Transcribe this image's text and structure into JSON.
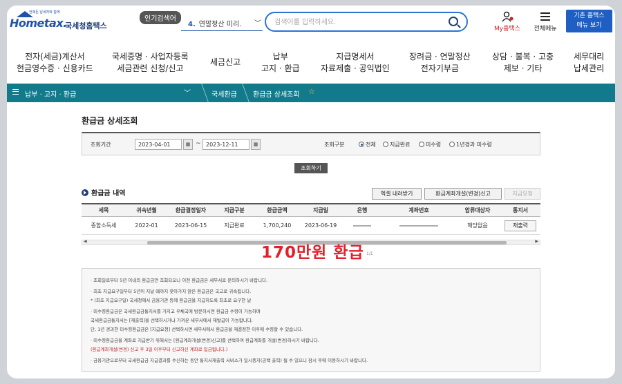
{
  "header": {
    "logo_sub": "언제든 납세자와 함께",
    "logo_main": "Hometax.",
    "logo_kr": "국세청홈택스",
    "popular_badge": "인기검색어",
    "popular_rank": "4.",
    "popular_term": "연말정산 미리.",
    "search_placeholder": "검색어를 입력하세요.",
    "myhome_label": "My홈택스",
    "allmenu_label": "전체메뉴",
    "classic_line1": "기존 홈택스",
    "classic_line2": "메뉴 보기"
  },
  "gnb": [
    {
      "line1": "전자(세금)계산서",
      "line2": "현금영수증 · 신용카드"
    },
    {
      "line1": "국세증명 · 사업자등록",
      "line2": "세금관련 신청/신고"
    },
    {
      "line1": "세금신고",
      "line2": ""
    },
    {
      "line1": "납부",
      "line2": "고지 · 환급"
    },
    {
      "line1": "지급명세서",
      "line2": "자료제출 · 공익법인"
    },
    {
      "line1": "장려금 · 연말정산",
      "line2": "전자기부금"
    },
    {
      "line1": "상담 · 불복 · 고충",
      "line2": "제보 · 기타"
    },
    {
      "line1": "세무대리",
      "line2": "납세관리"
    }
  ],
  "breadcrumb": {
    "level1": "납부 · 고지 · 환급",
    "level2": "국세환급",
    "level3": "환급금 상세조회"
  },
  "page_title": "환급금 상세조회",
  "filter": {
    "period_label": "조회기간",
    "date_from": "2023-04-01",
    "date_to": "2023-12-11",
    "tilde": "~",
    "type_label": "조회구분",
    "options": [
      "전체",
      "지급완료",
      "미수령",
      "1년경과 미수령"
    ],
    "selected": "전체",
    "search_button": "조회하기"
  },
  "refunds": {
    "title": "환급금 내역",
    "excel_button": "엑셀 내려받기",
    "account_button": "환급계좌개설(변경)신고",
    "request_button": "지급요청",
    "columns": [
      "세목",
      "귀속년월",
      "환급결정일자",
      "지급구분",
      "환급금액",
      "지급일",
      "은행",
      "계좌번호",
      "압류대상자",
      "통지서"
    ],
    "rows": [
      {
        "tax": "종합소득세",
        "period": "2022-01",
        "decision_date": "2023-06-15",
        "pay_type": "지급완료",
        "amount": "1,700,240",
        "pay_date": "2023-06-19",
        "bank": "",
        "account": "",
        "seizure": "해당없음",
        "notice": "재출력"
      }
    ],
    "pager": "1/1"
  },
  "overlay_caption": "170만원 환급",
  "notices": [
    {
      "text": "· 조회일로부터 5년 이내의 환급금만 조회되오니 이전 환급금은 세무서로 문의하시기 바랍니다.",
      "red": false
    },
    {
      "text": "· 최초 지급요구일부터 5년이 지날 때까지 찾아가지 않은 환급금은 국고로 귀속됩니다.",
      "red": false
    },
    {
      "text": "   * (최초 지급요구일) 국세청에서 금융기관 등에 환급금을 지급하도록 최초로 요구한 날",
      "red": false
    },
    {
      "text": "· 미수령환급금은 국세환급금통지서를 가지고 우체국에 방문하시면 환급금 수령이 가능하며",
      "red": false
    },
    {
      "text": "  국세환급금통지서는 [재출력]을 선택하시거나 가까운 세무서에서 재발급이 가능합니다.",
      "red": false
    },
    {
      "text": "  단, 1년 경과한 미수령환급금은 [지급요청] 선택하시면 세무서에서 환급금을 재결정한 이후에 수령할 수 있습니다.",
      "red": false
    },
    {
      "text": "· 미수령환급금을 계좌로 지급받기 위해서는 [환급계좌개설(변경)신고]를 선택하여 환급계좌를 개설(변경)하시기 바랍니다.",
      "red": false
    },
    {
      "text": "  (환급계좌개설(변경) 신고 후 3일 이후부터 신고하신 계좌로 입금됩니다.)",
      "red": true
    },
    {
      "text": "· 금융기관으로부터 국세환급금 지급결과를 수신하는 동안 통지서재출력 서비스가 일시중지(공백 출력) 될 수 있으니 잠시 후에 이용하시기 바랍니다.",
      "red": false
    }
  ],
  "colors": {
    "brand_blue": "#1f54a8",
    "teal_bar": "#127a8a",
    "overlay_red": "#e3202b"
  }
}
